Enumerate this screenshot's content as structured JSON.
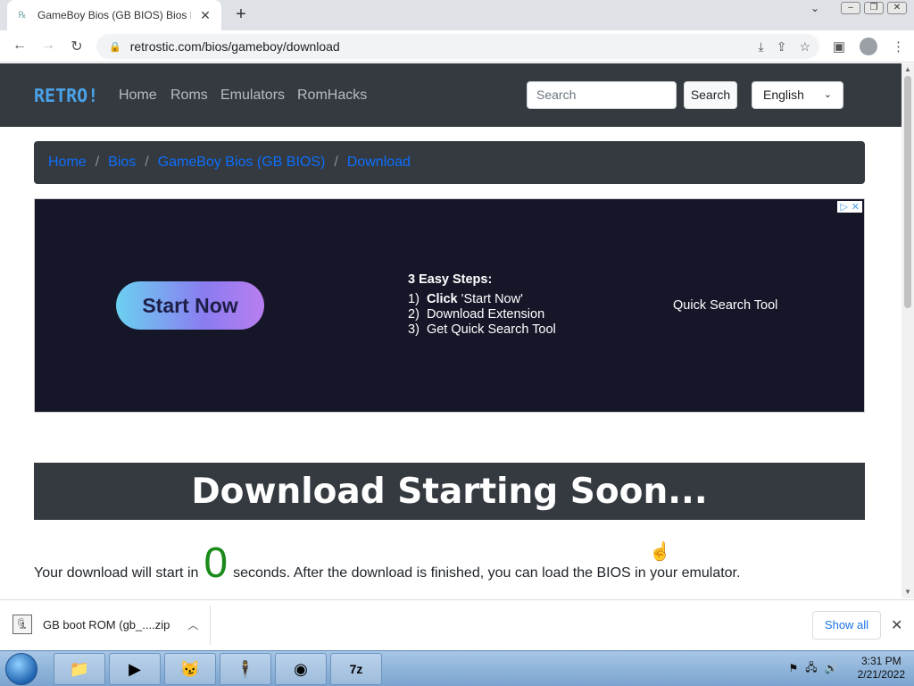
{
  "browser": {
    "tab_title": "GameBoy Bios (GB BIOS) Bios Do",
    "tab_favicon": "retro-favicon",
    "url": "retrostic.com/bios/gameboy/download"
  },
  "site": {
    "brand": "RETRO!",
    "nav": [
      "Home",
      "Roms",
      "Emulators",
      "RomHacks"
    ],
    "search_placeholder": "Search",
    "search_button": "Search",
    "language": "English"
  },
  "breadcrumb": [
    "Home",
    "Bios",
    "GameBoy Bios (GB BIOS)",
    "Download"
  ],
  "ad": {
    "start_button": "Start Now",
    "steps_title": "3 Easy Steps:",
    "step1_num": "1)",
    "step1_bold": "Click",
    "step1_rest": " 'Start Now'",
    "step2": "2)  Download Extension",
    "step3": "3)  Get Quick Search Tool",
    "side_text": "Quick Search Tool"
  },
  "download": {
    "banner": "Download Starting Soon...",
    "text_before": "Your download will start in",
    "countdown": "0",
    "text_after": "seconds. After the download is finished, you can load the BIOS in your emulator."
  },
  "download_bar": {
    "file_name": "GB boot ROM (gb_....zip",
    "show_all": "Show all"
  },
  "taskbar": {
    "time": "3:31 PM",
    "date": "2/21/2022"
  }
}
